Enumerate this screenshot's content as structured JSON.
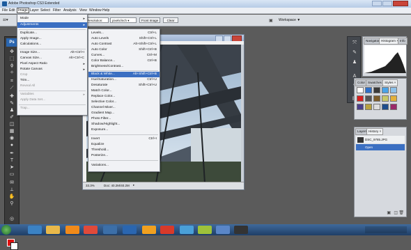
{
  "window": {
    "title": "Adobe Photoshop CS3 Extended"
  },
  "menubar": [
    "File",
    "Edit",
    "Image",
    "Layer",
    "Select",
    "Filter",
    "Analysis",
    "View",
    "Window",
    "Help"
  ],
  "options_bar": {
    "mode_label": "Mode",
    "resolution_label": "Resolution:",
    "resolution_unit": "pixels/inch",
    "front_image": "Front Image",
    "clear": "Clear",
    "workspace": "Workspace ▼"
  },
  "image_menu": {
    "items": [
      {
        "label": "Mode",
        "shortcut": "",
        "submenu": true,
        "disabled": false
      },
      {
        "label": "Adjustments",
        "shortcut": "",
        "submenu": true,
        "disabled": false,
        "highlight": true
      },
      {
        "label": "Duplicate...",
        "shortcut": "",
        "disabled": false
      },
      {
        "label": "Apply Image...",
        "shortcut": "",
        "disabled": false
      },
      {
        "label": "Calculations...",
        "shortcut": "",
        "disabled": false
      },
      {
        "label": "Image Size...",
        "shortcut": "Alt+Ctrl+I",
        "disabled": false
      },
      {
        "label": "Canvas Size...",
        "shortcut": "Alt+Ctrl+C",
        "disabled": false
      },
      {
        "label": "Pixel Aspect Ratio",
        "shortcut": "",
        "submenu": true,
        "disabled": false
      },
      {
        "label": "Rotate Canvas",
        "shortcut": "",
        "submenu": true,
        "disabled": false
      },
      {
        "label": "Crop",
        "shortcut": "",
        "disabled": true
      },
      {
        "label": "Trim...",
        "shortcut": "",
        "disabled": false
      },
      {
        "label": "Reveal All",
        "shortcut": "",
        "disabled": true
      },
      {
        "label": "Variables",
        "shortcut": "",
        "submenu": true,
        "disabled": true
      },
      {
        "label": "Apply Data Set...",
        "shortcut": "",
        "disabled": true
      },
      {
        "label": "Trap...",
        "shortcut": "",
        "disabled": true
      }
    ]
  },
  "adjustments_menu": {
    "items": [
      {
        "label": "Levels...",
        "shortcut": "Ctrl+L"
      },
      {
        "label": "Auto Levels",
        "shortcut": "Shift+Ctrl+L"
      },
      {
        "label": "Auto Contrast",
        "shortcut": "Alt+Shift+Ctrl+L"
      },
      {
        "label": "Auto Color",
        "shortcut": "Shift+Ctrl+B"
      },
      {
        "label": "Curves...",
        "shortcut": "Ctrl+M"
      },
      {
        "label": "Color Balance...",
        "shortcut": "Ctrl+B"
      },
      {
        "label": "Brightness/Contrast...",
        "shortcut": ""
      },
      {
        "label": "Black & White...",
        "shortcut": "Alt+Shift+Ctrl+B",
        "highlight": true
      },
      {
        "label": "Hue/Saturation...",
        "shortcut": "Ctrl+U"
      },
      {
        "label": "Desaturate",
        "shortcut": "Shift+Ctrl+U"
      },
      {
        "label": "Match Color...",
        "shortcut": ""
      },
      {
        "label": "Replace Color...",
        "shortcut": ""
      },
      {
        "label": "Selective Color...",
        "shortcut": ""
      },
      {
        "label": "Channel Mixer...",
        "shortcut": ""
      },
      {
        "label": "Gradient Map...",
        "shortcut": ""
      },
      {
        "label": "Photo Filter...",
        "shortcut": ""
      },
      {
        "label": "Shadow/Highlight...",
        "shortcut": ""
      },
      {
        "label": "Exposure...",
        "shortcut": ""
      },
      {
        "label": "Invert",
        "shortcut": "Ctrl+I"
      },
      {
        "label": "Equalize",
        "shortcut": ""
      },
      {
        "label": "Threshold...",
        "shortcut": ""
      },
      {
        "label": "Posterize...",
        "shortcut": ""
      },
      {
        "label": "Variations...",
        "shortcut": ""
      }
    ]
  },
  "document": {
    "zoom": "33.3%",
    "doc_size": "Doc: 40.2M/40.2M"
  },
  "panels": {
    "nav_tabs": [
      "Navigator",
      "Histogram ×",
      "Info"
    ],
    "color_tabs": [
      "Color",
      "Swatches",
      "Styles ×"
    ],
    "layer_tabs": [
      "Layers",
      "History ×"
    ],
    "history_items": [
      "DSC_9785.JPG",
      "Open"
    ]
  },
  "colors": {
    "highlight": "#3b6fc2",
    "foreground": "#e01010",
    "background": "#ffffff"
  }
}
